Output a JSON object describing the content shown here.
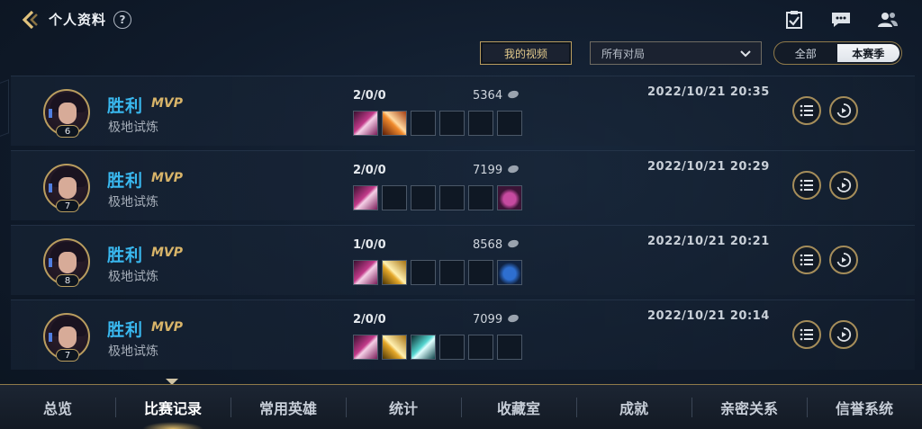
{
  "header": {
    "title": "个人资料",
    "help_label": "?",
    "icons": [
      "back-icon",
      "task-icon",
      "chat-icon",
      "friends-icon"
    ]
  },
  "filters": {
    "video_button": "我的视频",
    "match_filter": "所有对局",
    "season_options": [
      "全部",
      "本赛季"
    ],
    "season_selected": "本赛季"
  },
  "matches": [
    {
      "level": "6",
      "result": "胜利",
      "mvp": "MVP",
      "mode": "极地试炼",
      "kda": "2/0/0",
      "gold": "5364",
      "date": "2022/10/21 20:35",
      "items": [
        "i1",
        "i2",
        "",
        "",
        "",
        ""
      ]
    },
    {
      "level": "7",
      "result": "胜利",
      "mvp": "MVP",
      "mode": "极地试炼",
      "kda": "2/0/0",
      "gold": "7199",
      "date": "2022/10/21 20:29",
      "items": [
        "i1",
        "",
        "",
        "",
        "",
        "i5"
      ]
    },
    {
      "level": "8",
      "result": "胜利",
      "mvp": "MVP",
      "mode": "极地试炼",
      "kda": "1/0/0",
      "gold": "8568",
      "date": "2022/10/21 20:21",
      "items": [
        "i1",
        "i3",
        "",
        "",
        "",
        "i6"
      ]
    },
    {
      "level": "7",
      "result": "胜利",
      "mvp": "MVP",
      "mode": "极地试炼",
      "kda": "2/0/0",
      "gold": "7099",
      "date": "2022/10/21 20:14",
      "items": [
        "i1",
        "i3",
        "i4",
        "",
        "",
        ""
      ]
    }
  ],
  "tabs": [
    "总览",
    "比赛记录",
    "常用英雄",
    "统计",
    "收藏室",
    "成就",
    "亲密关系",
    "信誉系统"
  ],
  "active_tab": "比赛记录",
  "colors": {
    "accent_gold": "#b99d5f",
    "win_blue": "#39b8ef",
    "mvp_gold": "#d8b469"
  }
}
